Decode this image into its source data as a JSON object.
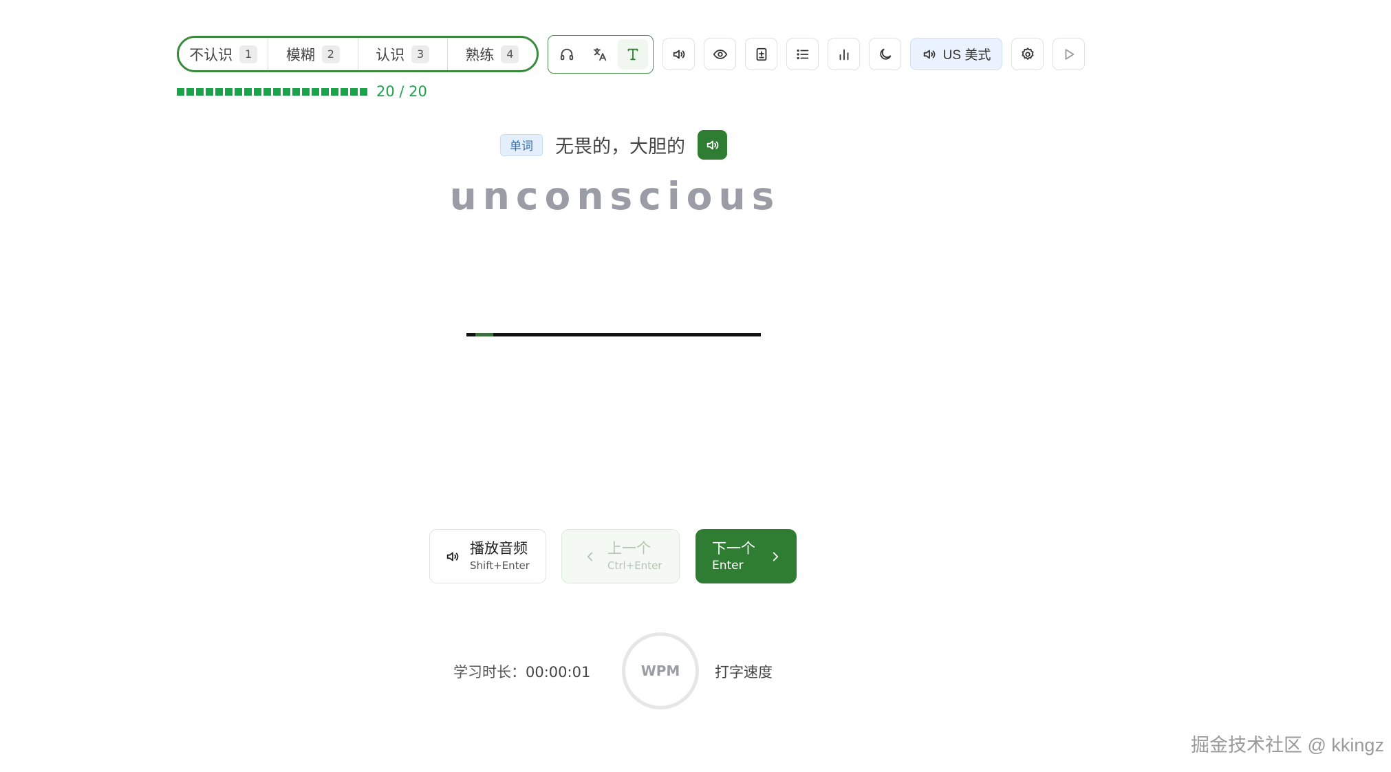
{
  "toolbar": {
    "ratings": [
      {
        "label": "不认识",
        "key": "1"
      },
      {
        "label": "模糊",
        "key": "2"
      },
      {
        "label": "认识",
        "key": "3"
      },
      {
        "label": "熟练",
        "key": "4"
      }
    ],
    "modes": [
      "headphones-icon",
      "translate-icon",
      "text-icon"
    ],
    "active_mode": "text-icon",
    "tools": [
      "volume-icon",
      "eye-icon",
      "add-note-icon",
      "list-icon",
      "chart-icon",
      "moon-icon"
    ],
    "accent_label": "US 美式",
    "accent_icon": "volume-icon",
    "extra_tools": [
      "gear-icon",
      "play-icon"
    ]
  },
  "progress": {
    "done": 20,
    "total": 20,
    "text": "20 / 20",
    "color": "#1aa34a"
  },
  "word": {
    "type_badge": "单词",
    "meaning": "无畏的，大胆的",
    "text": "unconscious"
  },
  "actions": {
    "play": {
      "label": "播放音频",
      "shortcut": "Shift+Enter"
    },
    "prev": {
      "label": "上一个",
      "shortcut": "Ctrl+Enter"
    },
    "next": {
      "label": "下一个",
      "shortcut": "Enter"
    }
  },
  "stats": {
    "study_time_label": "学习时长：",
    "study_time_value": "00:00:01",
    "wpm_label": "WPM",
    "typing_speed_label": "打字速度"
  },
  "watermark": "掘金技术社区 @ kkingz",
  "colors": {
    "brand_green": "#2e7d32",
    "progress_green": "#1aa34a",
    "accent_blue_bg": "#eaf3fd"
  }
}
